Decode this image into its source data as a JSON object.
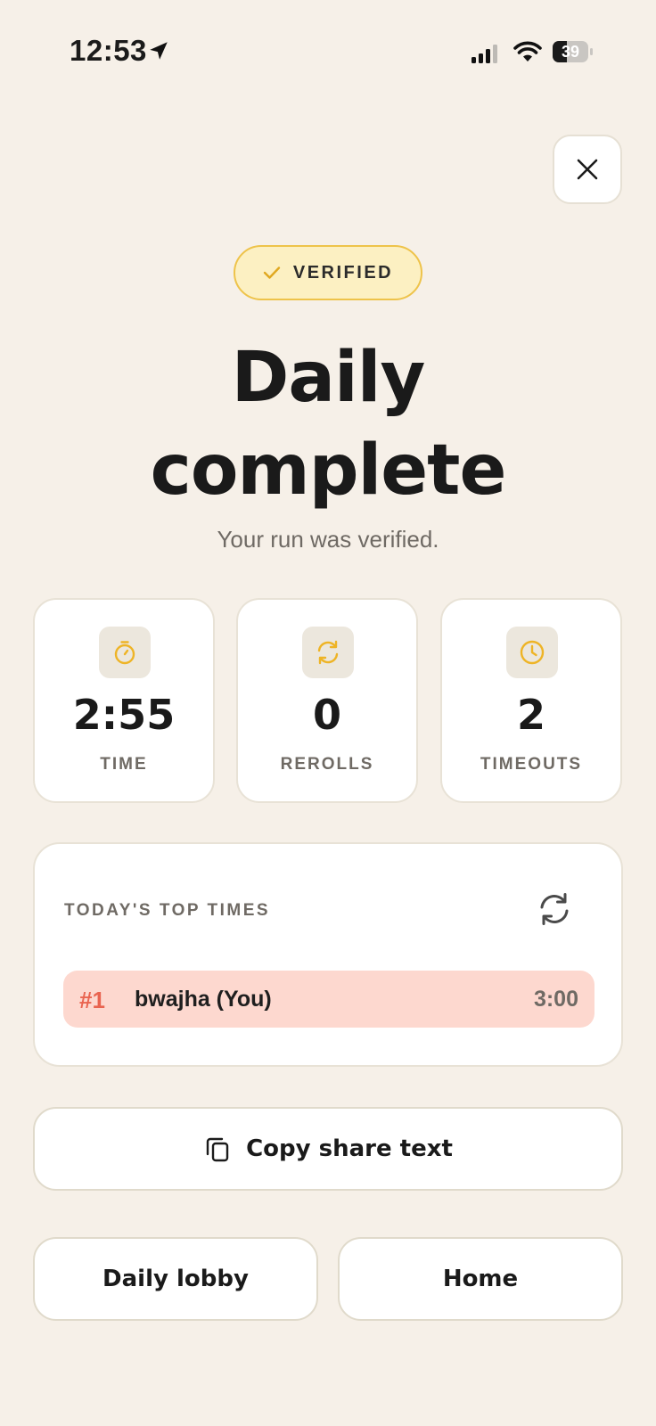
{
  "status_bar": {
    "time": "12:53",
    "battery_level": "39",
    "battery_fraction": 0.39
  },
  "colors": {
    "accent": "#eeb426",
    "badge_bg": "#fcf0c2",
    "highlight_row": "#fdd8cf",
    "rank_color": "#e96450",
    "background": "#f6f0e8"
  },
  "badge": {
    "label": "VERIFIED",
    "icon": "check-icon"
  },
  "title": {
    "line1": "Daily",
    "line2": "complete"
  },
  "subtitle": "Your run was verified.",
  "stats": [
    {
      "icon": "stopwatch-icon",
      "value": "2:55",
      "label": "TIME"
    },
    {
      "icon": "refresh-icon",
      "value": "0",
      "label": "REROLLS"
    },
    {
      "icon": "clock-icon",
      "value": "2",
      "label": "TIMEOUTS"
    }
  ],
  "leaderboard": {
    "header": "TODAY'S TOP TIMES",
    "refresh_icon": "refresh-icon",
    "rows": [
      {
        "rank": "#1",
        "name": "bwajha (You)",
        "time": "3:00"
      }
    ]
  },
  "actions": {
    "copy_label": "Copy share text",
    "copy_icon": "copy-icon",
    "lobby_label": "Daily lobby",
    "home_label": "Home"
  }
}
